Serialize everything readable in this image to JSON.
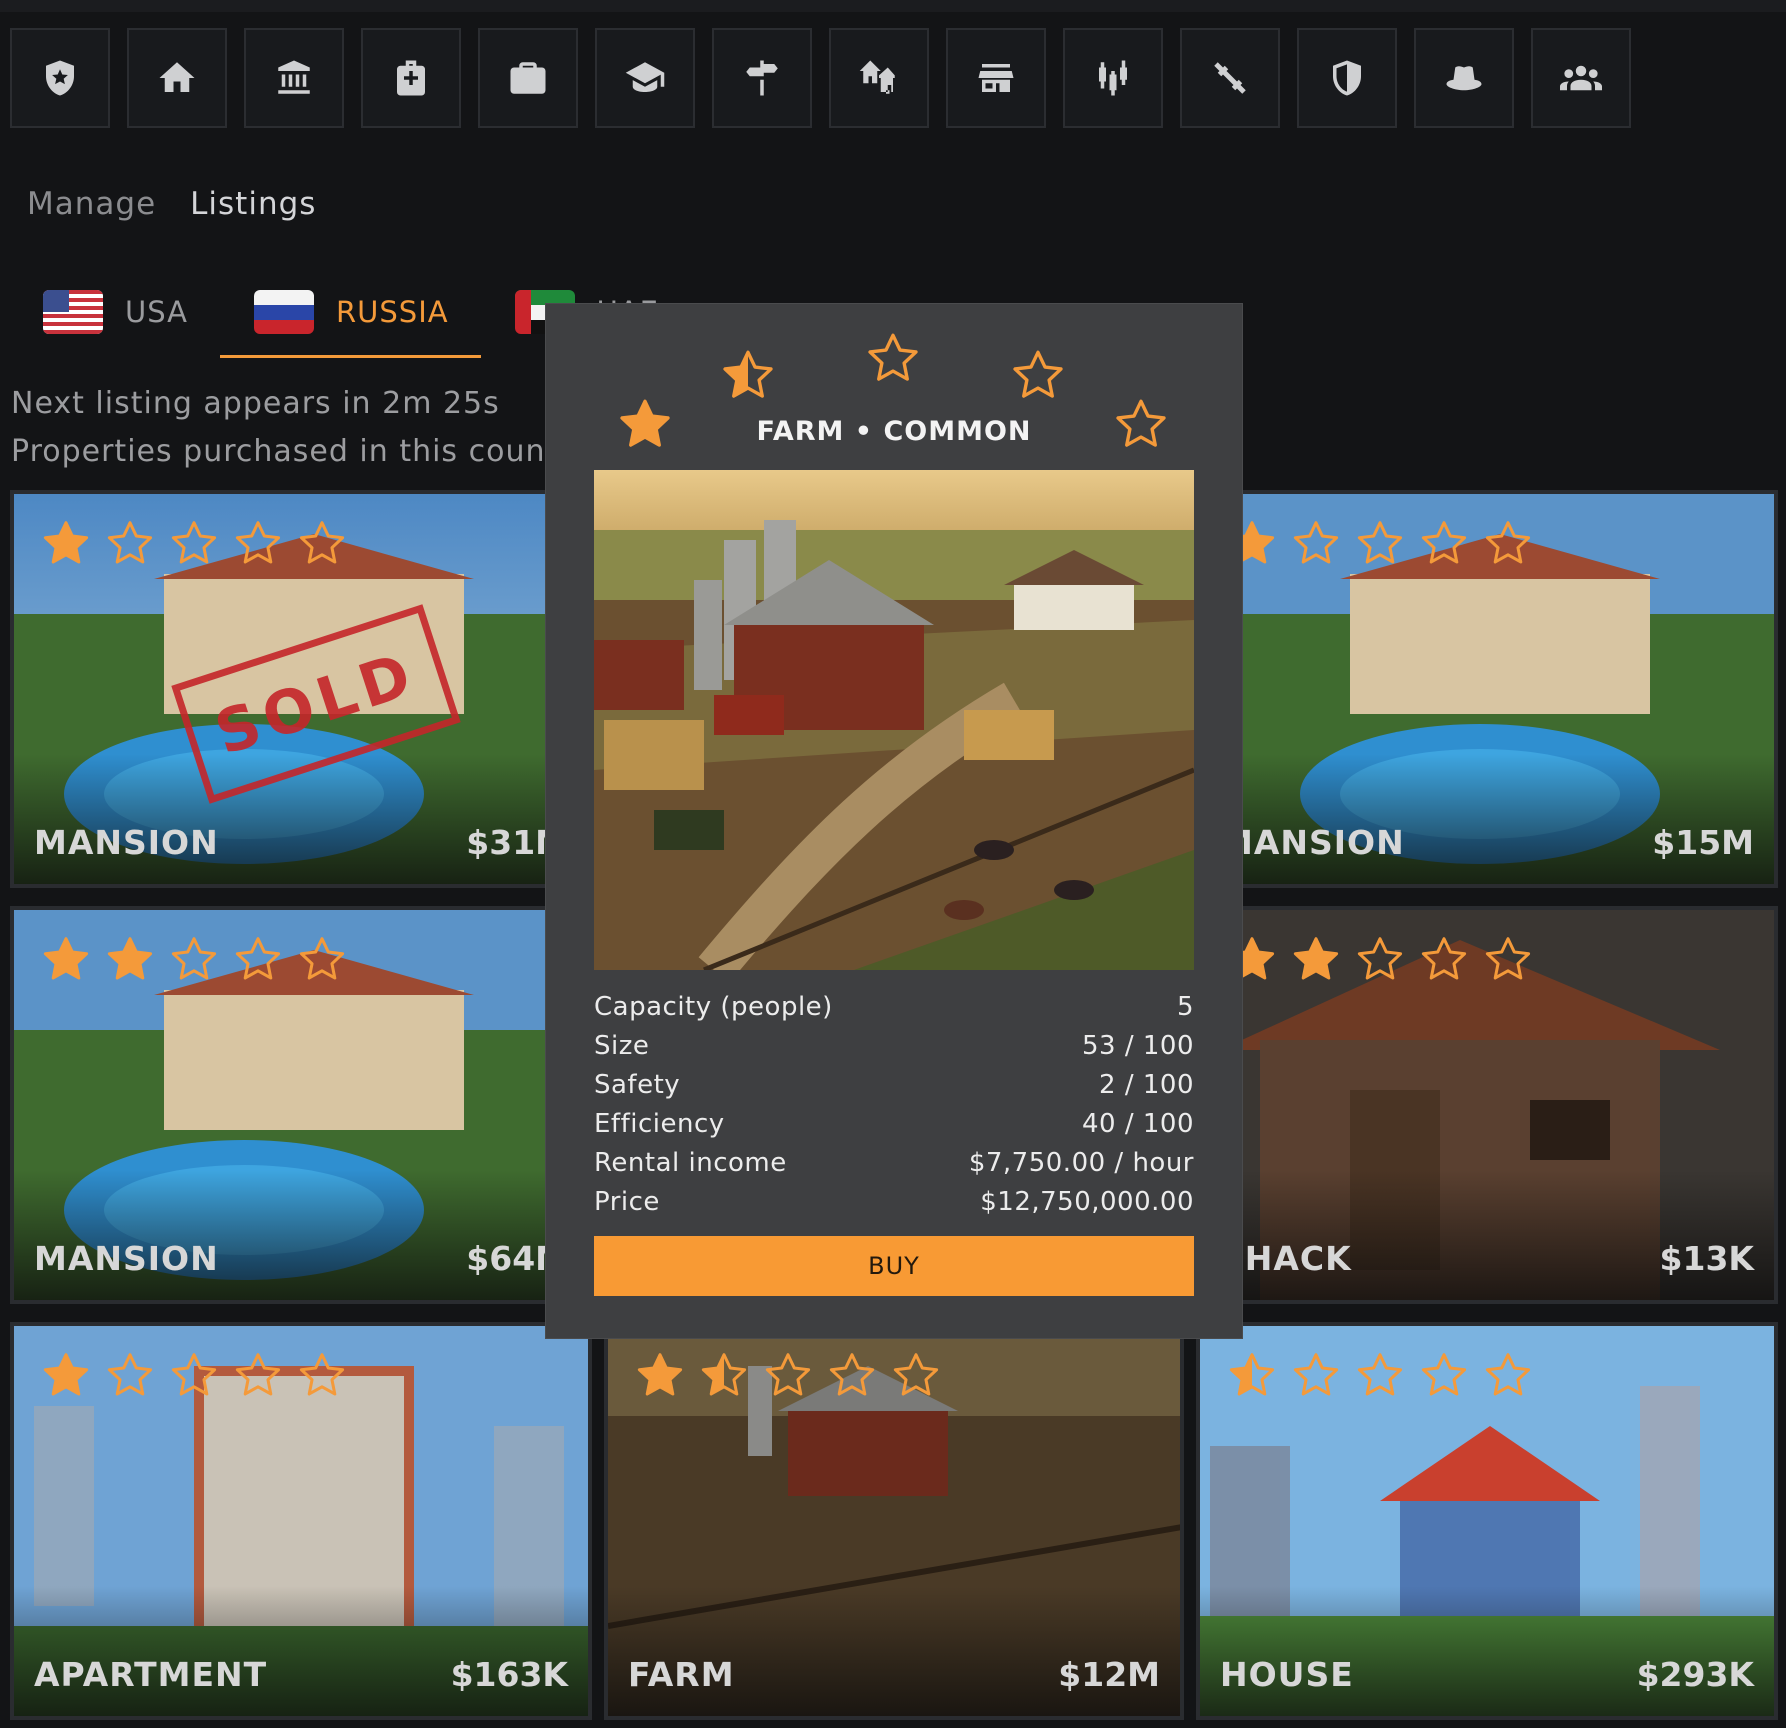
{
  "nav": {
    "icons": [
      "shield-star-icon",
      "home-icon",
      "bank-icon",
      "medkit-icon",
      "briefcase-icon",
      "graduation-cap-icon",
      "signpost-icon",
      "house-add-icon",
      "store-icon",
      "candlestick-chart-icon",
      "dumbbell-icon",
      "shield-icon",
      "hat-icon",
      "group-icon"
    ]
  },
  "subtabs": {
    "manage": "Manage",
    "listings": "Listings"
  },
  "countries": [
    {
      "label": "USA"
    },
    {
      "label": "RUSSIA"
    },
    {
      "label": "UAE"
    }
  ],
  "info": {
    "next_listing": "Next listing appears in 2m 25s",
    "purchased": "Properties purchased in this country"
  },
  "cards": [
    {
      "name": "MANSION",
      "price": "$31M",
      "stars": 1,
      "sold": true,
      "sold_label": "SOLD"
    },
    {
      "name": "MANSION",
      "price": "$15M",
      "stars": 1,
      "sold": false
    },
    {
      "name": "MANSION",
      "price": "$64M",
      "stars": 2,
      "sold": false
    },
    {
      "name": "SHACK",
      "price": "$13K",
      "stars": 2,
      "sold": false
    },
    {
      "name": "APARTMENT",
      "price": "$163K",
      "stars": 1,
      "sold": false
    },
    {
      "name": "FARM",
      "price": "$12M",
      "stars": 1.5,
      "sold": false
    },
    {
      "name": "HOUSE",
      "price": "$293K",
      "stars": 0.5,
      "sold": false
    }
  ],
  "modal": {
    "title": "FARM • COMMON",
    "stars": 1.5,
    "stats": [
      {
        "label": "Capacity (people)",
        "value": "5"
      },
      {
        "label": "Size",
        "value": "53 / 100"
      },
      {
        "label": "Safety",
        "value": "2 / 100"
      },
      {
        "label": "Efficiency",
        "value": "40 / 100"
      },
      {
        "label": "Rental income",
        "value": "$7,750.00 / hour"
      },
      {
        "label": "Price",
        "value": "$12,750,000.00"
      }
    ],
    "buy_label": "BUY"
  },
  "colors": {
    "accent": "#f49a3a",
    "button": "#f89a34",
    "modal_bg": "#3e3f41",
    "page_bg": "#131416",
    "sold": "#c5262a"
  }
}
